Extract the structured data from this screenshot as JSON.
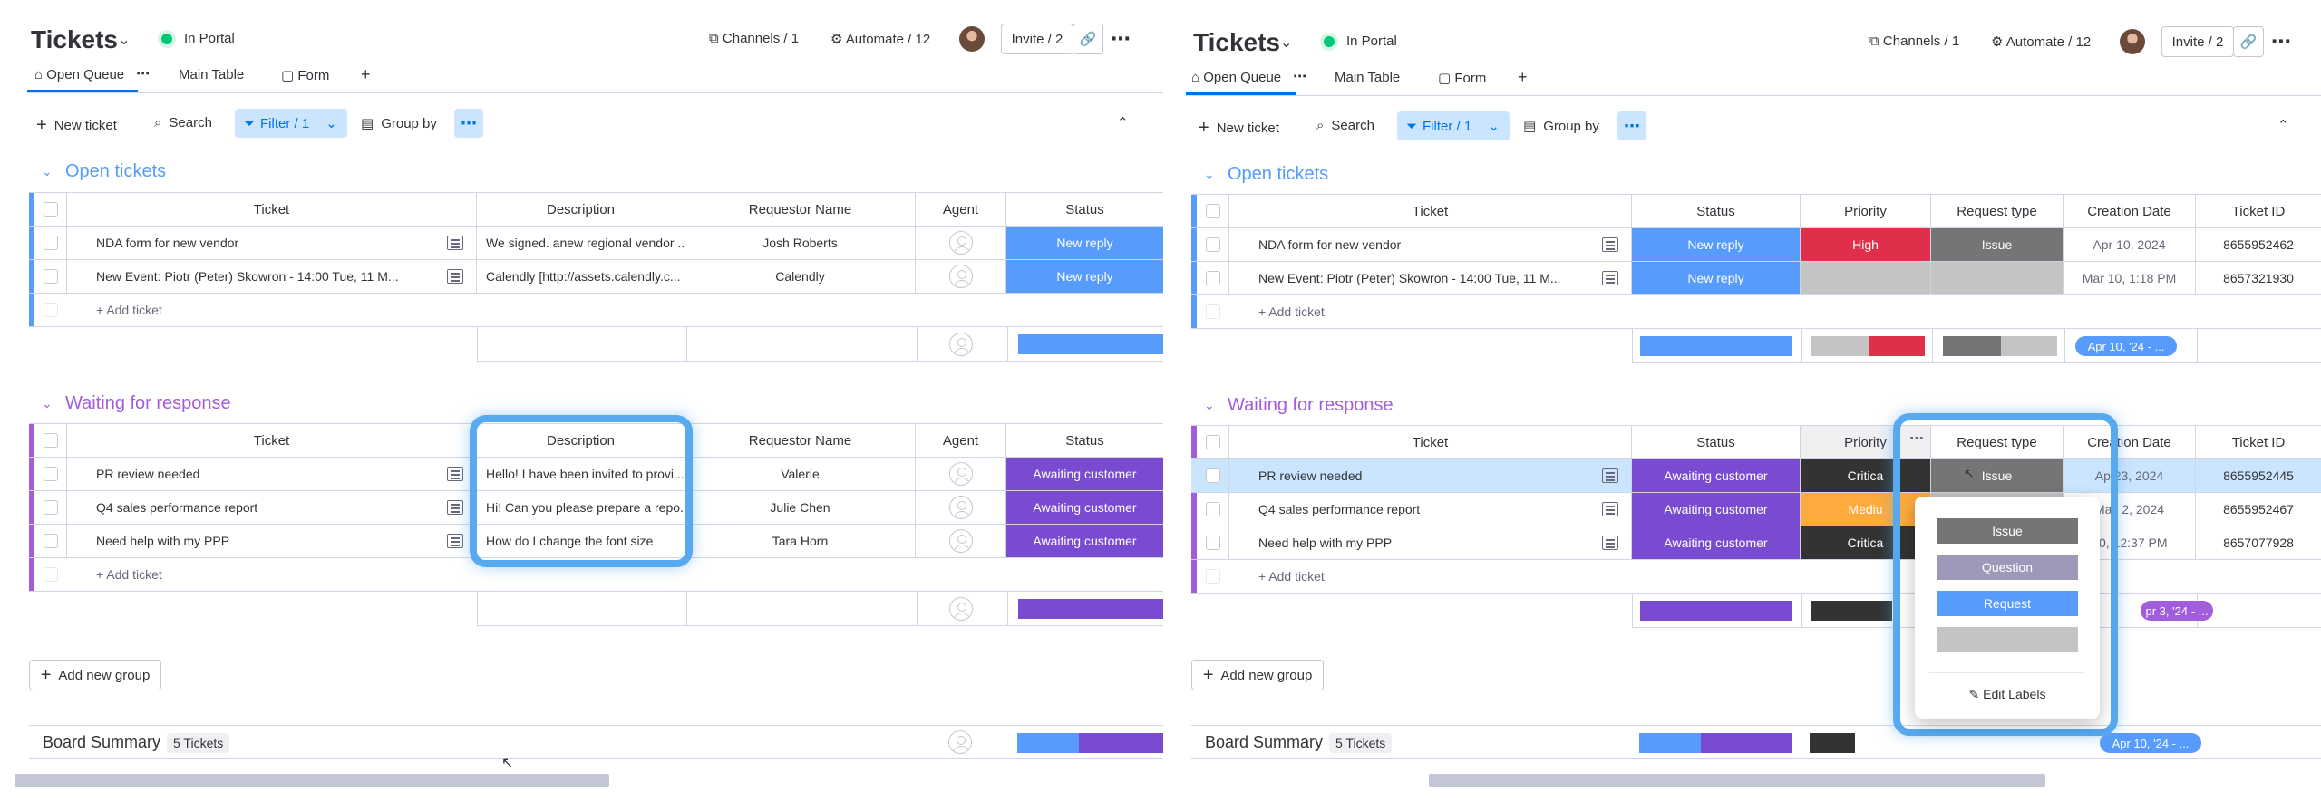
{
  "colors": {
    "blue": "#579bfc",
    "purple": "#784bd1",
    "green": "#00c875",
    "red": "#df2f4a",
    "orange": "#fdab3d",
    "dark": "#333333",
    "issue": "#757575",
    "question": "#9d99b9",
    "request": "#579bfc",
    "grey": "#c4c4c4",
    "open_group": "#579bfc",
    "waiting_group": "#a25ddc"
  },
  "header": {
    "title": "Tickets",
    "status": "In Portal",
    "channels": "Channels / 1",
    "automate": "Automate / 12",
    "invite": "Invite / 2"
  },
  "tabs": [
    "Open Queue",
    "Main Table",
    "Form"
  ],
  "toolbar": {
    "new": "New ticket",
    "search": "Search",
    "filter": "Filter / 1",
    "group": "Group by"
  },
  "left": {
    "columns": [
      "Ticket",
      "Description",
      "Requestor Name",
      "Agent",
      "Status"
    ],
    "open": {
      "title": "Open tickets",
      "rows": [
        {
          "ticket": "NDA form for new vendor",
          "desc": "We signed. anew regional vendor ...",
          "req": "Josh Roberts",
          "status": "New reply"
        },
        {
          "ticket": "New Event: Piotr (Peter) Skowron - 14:00 Tue, 11 M...",
          "desc": "Calendly [http://assets.calendly.c...",
          "req": "Calendly",
          "status": "New reply"
        }
      ]
    },
    "waiting": {
      "title": "Waiting for response",
      "rows": [
        {
          "ticket": "PR review needed",
          "desc": "Hello! I have been invited to provi...",
          "req": "Valerie",
          "status": "Awaiting customer"
        },
        {
          "ticket": "Q4 sales performance report",
          "desc": "Hi! Can you please prepare a repo...",
          "req": "Julie Chen",
          "status": "Awaiting customer"
        },
        {
          "ticket": "Need help with my PPP",
          "desc": "How do I change the font size",
          "req": "Tara Horn",
          "status": "Awaiting customer"
        }
      ]
    }
  },
  "right": {
    "columns": [
      "Ticket",
      "Status",
      "Priority",
      "Request type",
      "Creation Date",
      "Ticket ID"
    ],
    "open": {
      "title": "Open tickets",
      "rows": [
        {
          "ticket": "NDA form for new vendor",
          "status": "New reply",
          "priority": "High",
          "type": "Issue",
          "date": "Apr 10, 2024",
          "id": "8655952462"
        },
        {
          "ticket": "New Event: Piotr (Peter) Skowron - 14:00 Tue, 11 M...",
          "status": "New reply",
          "priority": "",
          "type": "",
          "date": "Mar 10, 1:18 PM",
          "id": "8657321930"
        }
      ]
    },
    "waiting": {
      "title": "Waiting for response",
      "rows": [
        {
          "ticket": "PR review needed",
          "status": "Awaiting customer",
          "priority": "Critica",
          "type": "Issue",
          "date": "Ap 23, 2024",
          "id": "8655952445"
        },
        {
          "ticket": "Q4 sales performance report",
          "status": "Awaiting customer",
          "priority": "Mediu",
          "type": "",
          "date": "May 2, 2024",
          "id": "8655952467"
        },
        {
          "ticket": "Need help with my PPP",
          "status": "Awaiting customer",
          "priority": "Critica",
          "type": "",
          "date": "r 0, 12:37 PM",
          "id": "8657077928"
        }
      ]
    },
    "date_summary_open": "Apr 10, '24 - ...",
    "date_summary_wait": "pr 3, '24 - ...",
    "date_summary_board": "Apr 10, '24 - ..."
  },
  "add_ticket": "+ Add ticket",
  "add_group": "Add new group",
  "board_summary": "Board Summary",
  "tickets_badge": "5 Tickets",
  "dropdown": {
    "items": [
      "Issue",
      "Question",
      "Request",
      ""
    ],
    "edit": "Edit Labels"
  }
}
